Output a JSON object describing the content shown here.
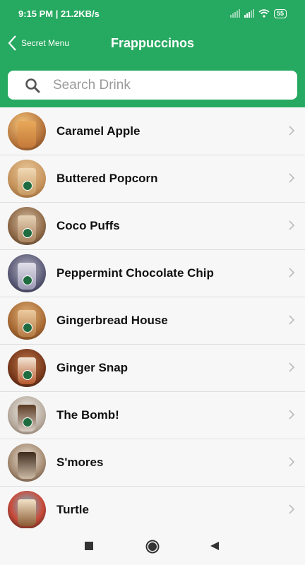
{
  "status": {
    "time_speed": "9:15 PM | 21.2KB/s",
    "battery": "55"
  },
  "header": {
    "back_label": "Secret Menu",
    "title": "Frappuccinos"
  },
  "search": {
    "placeholder": "Search Drink"
  },
  "drinks": [
    {
      "label": "Caramel Apple"
    },
    {
      "label": "Buttered Popcorn"
    },
    {
      "label": "Coco Puffs"
    },
    {
      "label": "Peppermint Chocolate Chip"
    },
    {
      "label": "Gingerbread House"
    },
    {
      "label": "Ginger Snap"
    },
    {
      "label": "The Bomb!"
    },
    {
      "label": "S'mores"
    },
    {
      "label": "Turtle"
    }
  ],
  "colors": {
    "accent": "#26a960"
  }
}
